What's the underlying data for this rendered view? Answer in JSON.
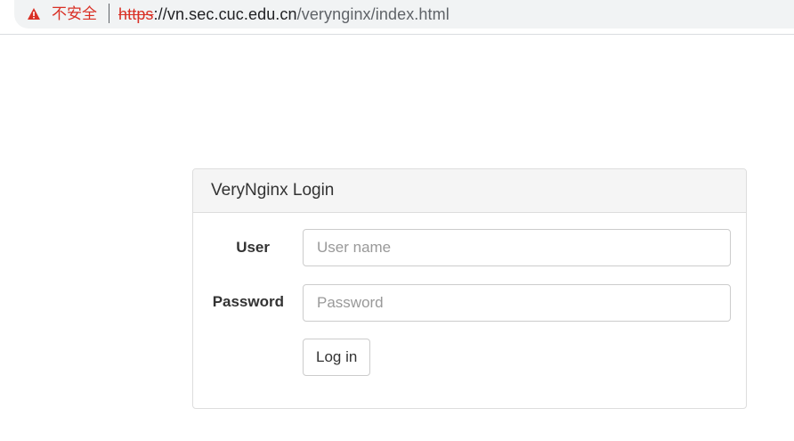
{
  "browser": {
    "security_label": "不安全",
    "url_scheme": "https",
    "url_separator": "://",
    "url_host": "vn.sec.cuc.edu.cn",
    "url_path": "/verynginx/index.html",
    "warning_icon": "warning-triangle-icon",
    "warning_color": "#d93025"
  },
  "login": {
    "title": "VeryNginx Login",
    "user_label": "User",
    "user_placeholder": "User name",
    "user_value": "",
    "password_label": "Password",
    "password_placeholder": "Password",
    "password_value": "",
    "submit_label": "Log in"
  }
}
